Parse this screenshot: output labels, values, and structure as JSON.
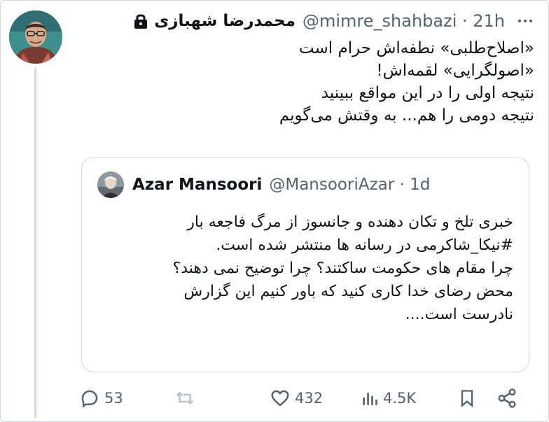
{
  "tweet": {
    "display_name": "محمدرضا شهبازی",
    "handle_time": "@mimre_shahbazi · 21h",
    "body_lines": [
      "«اصلاح‌طلبی» نطفه‌اش حرام است",
      "«اصولگرایی» لقمه‌اش!",
      "نتیجه اولی را در این مواقع ببینید",
      "نتیجه دومی را هم... به وقتش می‌گویم"
    ]
  },
  "quoted": {
    "display_name": "Azar Mansoori",
    "handle_time": "@MansooriAzar · 1d",
    "body_lines": [
      "خبری تلخ و تکان دهنده و جانسوز از مرگ فاجعه بار",
      "#نیکا_شاکرمی در رسانه ها منتشر شده است.",
      "چرا مقام های حکومت ساکتند؟ چرا توضیح نمی دهند؟",
      "محض رضای خدا کاری کنید که باور کنیم این گزارش",
      "نادرست است...."
    ]
  },
  "actions": {
    "replies": "53",
    "likes": "432",
    "views": "4.5K"
  },
  "colors": {
    "text": "#0f1419",
    "secondary": "#536471",
    "border": "#cfd9de"
  }
}
